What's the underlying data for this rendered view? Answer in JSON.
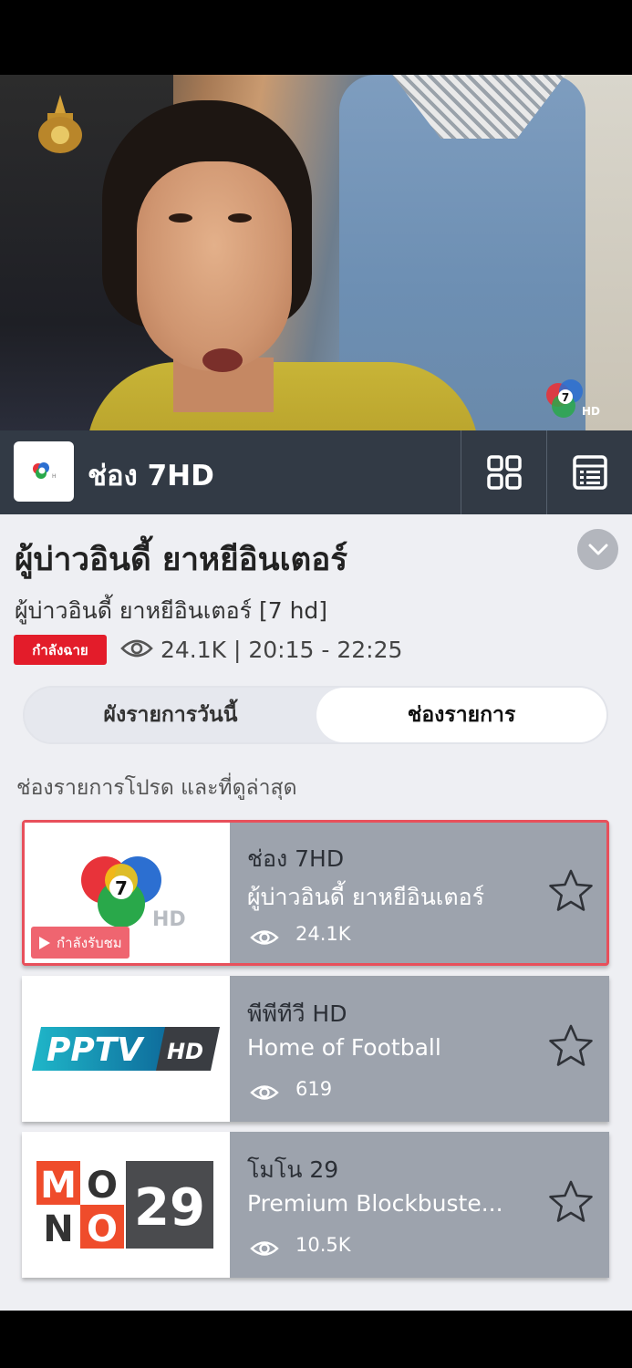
{
  "player": {
    "channel_label": "ช่อง 7HD"
  },
  "program": {
    "title": "ผู้บ่าวอินดี้ ยาหยีอินเตอร์",
    "subtitle": "ผู้บ่าวอินดี้ ยาหยีอินเตอร์ [7 hd]",
    "live_badge": "กำลังฉาย",
    "stats": "24.1K | 20:15 - 22:25"
  },
  "tabs": [
    {
      "label": "ผังรายการวันนี้",
      "selected": false
    },
    {
      "label": "ช่องรายการ",
      "selected": true
    }
  ],
  "section_title": "ช่องรายการโปรด และที่ดูล่าสุด",
  "channels": [
    {
      "name": "ช่อง 7HD",
      "program": "ผู้บ่าวอินดี้ ยาหยีอินเตอร์",
      "views": "24.1K",
      "watching_label": "กำลังรับชม",
      "logo": "ch7-logo"
    },
    {
      "name": "พีพีทีวี HD",
      "program": "Home of Football",
      "views": "619",
      "logo": "pptv-logo",
      "logo_text": "PPTV",
      "logo_suffix": "HD"
    },
    {
      "name": "โมโน 29",
      "program": "Premium Blockbuste...",
      "views": "10.5K",
      "logo": "mono29-logo",
      "logo_text": "MONO",
      "logo_number": "29"
    }
  ],
  "colors": {
    "header_bg": "#323a45",
    "live_red": "#e31c2a",
    "card_bg": "#9da3ad",
    "active_border": "#e8505b",
    "content_bg": "#eeeff3"
  }
}
